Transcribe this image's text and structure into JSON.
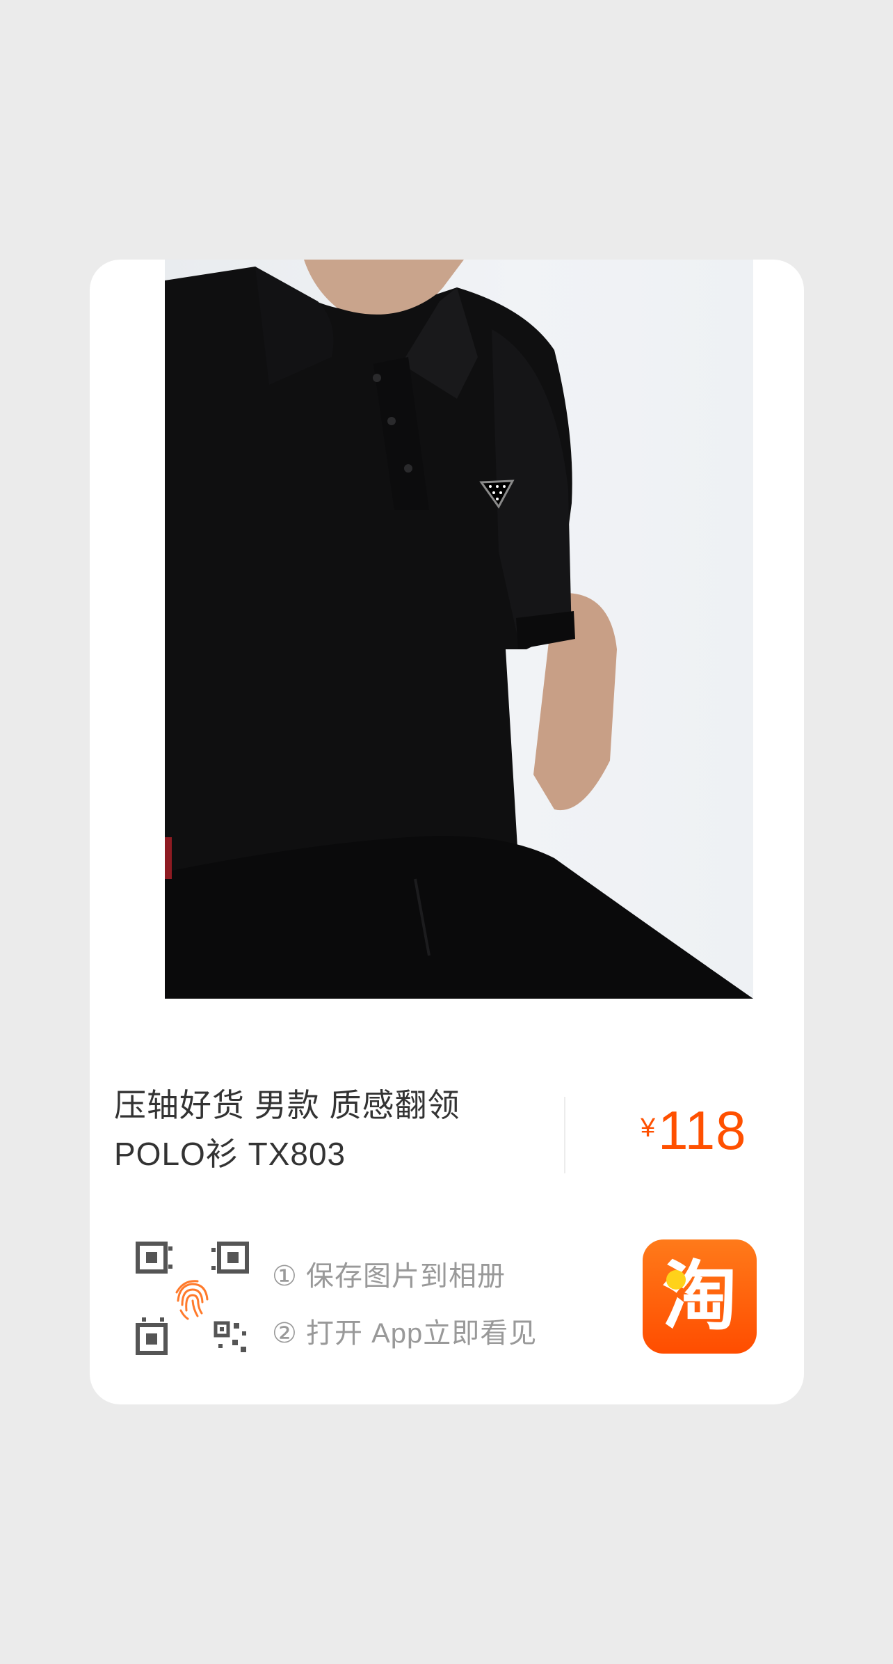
{
  "product": {
    "image_alt": "black polo shirt",
    "title_line1": "压轴好货 男款  质感翻领",
    "title_line2": "POLO衫 TX803",
    "currency": "¥",
    "price": "118"
  },
  "share": {
    "step1": "① 保存图片到相册",
    "step2": "② 打开 App立即看见",
    "qr_icon": "qr-scan-icon",
    "fingerprint_icon": "fingerprint-icon",
    "app_logo_glyph": "淘",
    "app_logo_icon": "taobao-logo"
  },
  "colors": {
    "background": "#ebebeb",
    "card": "#ffffff",
    "price": "#ff5000",
    "title": "#333333",
    "steps": "#999999",
    "logo": "#ff5000",
    "fingerprint": "#ff7a2b"
  }
}
